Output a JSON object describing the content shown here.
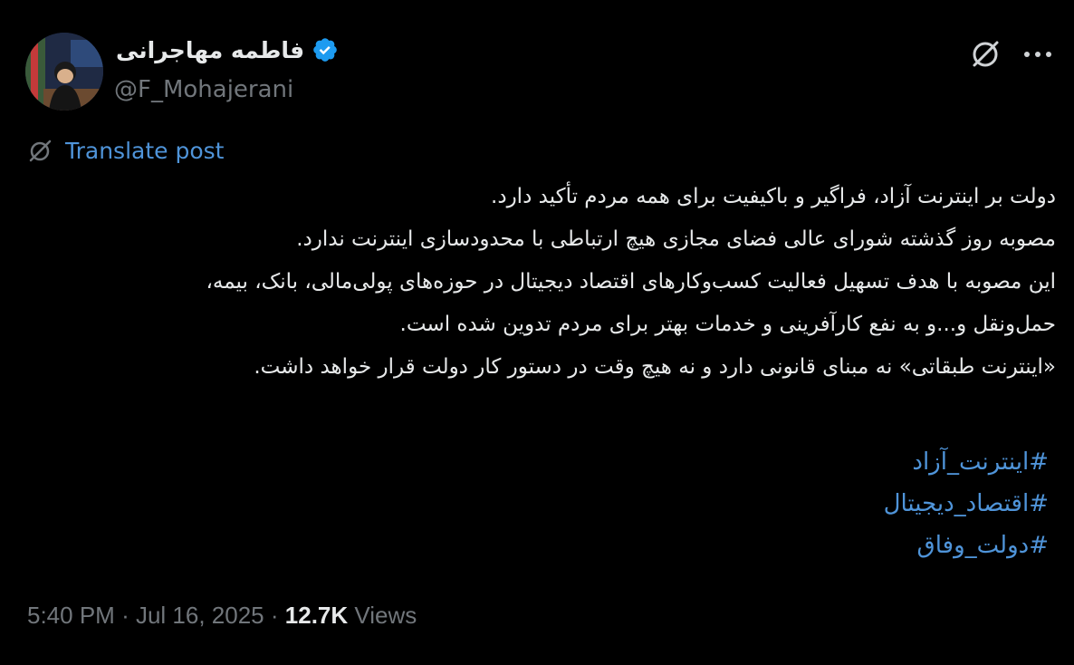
{
  "author": {
    "name": "فاطمه مهاجرانی",
    "handle": "@F_Mohajerani",
    "verified_color": "#1d9bf0"
  },
  "translate": {
    "label": "Translate post",
    "icon": "globe-slash-icon"
  },
  "post": {
    "lines": [
      "دولت بر اینترنت آزاد، فراگیر و باکیفیت برای همه مردم تأکید دارد.",
      "مصوبه روز گذشته شورای عالی فضای مجازی هیچ ارتباطی با محدودسازی اینترنت ندارد.",
      "این مصوبه با هدف تسهیل فعالیت کسب‌وکارهای اقتصاد دیجیتال در حوزه‌های پولی‌مالی، بانک، بیمه،",
      "حمل‌ونقل و...و به نفع کارآفرینی و خدمات بهتر برای مردم تدوین شده است.",
      "«اینترنت طبقاتی» نه مبنای قانونی دارد و نه هیچ وقت در دستور کار دولت قرار خواهد داشت."
    ],
    "hashtags": [
      "#اینترنت_آزاد",
      "#اقتصاد_دیجیتال",
      "#دولت_وفاق"
    ]
  },
  "meta": {
    "time": "5:40 PM",
    "separator": "·",
    "date": "Jul 16, 2025",
    "views_count": "12.7K",
    "views_label": "Views"
  },
  "colors": {
    "background": "#000000",
    "text": "#e7e9ea",
    "muted": "#71767b",
    "link": "#4f94d9"
  }
}
